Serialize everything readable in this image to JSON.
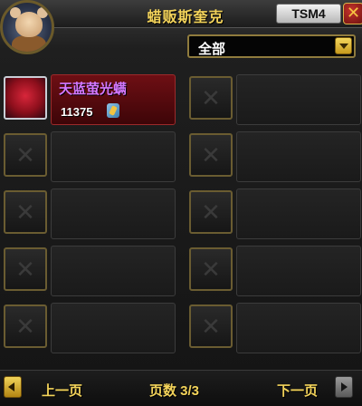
{
  "window": {
    "title": "蜡贩斯奎克",
    "tsm_button": "TSM4",
    "close_glyph": "✕"
  },
  "filter": {
    "selected": "全部"
  },
  "items": [
    {
      "name": "天蓝萤光螨",
      "price": "11375",
      "currency_icon": "gold-coin-icon"
    }
  ],
  "pagination": {
    "prev_label": "上一页",
    "page_label": "页数 3/3",
    "next_label": "下一页"
  },
  "colors": {
    "title": "#f3d35a",
    "item_name": "#d478ff",
    "filled_slot": "#6e0f14",
    "accent_gold": "#c79a1c"
  }
}
